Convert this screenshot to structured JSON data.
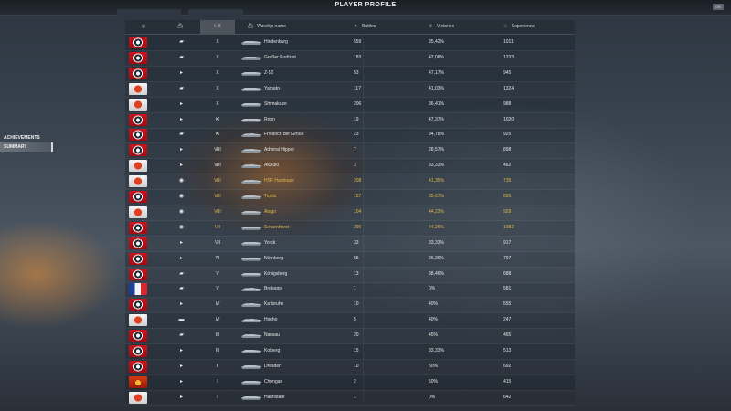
{
  "header": {
    "title": "PLAYER PROFILE",
    "settings_label": "ON"
  },
  "sidebar": {
    "items": [
      {
        "label": "ACHIEVEMENTS"
      },
      {
        "label": "SUMMARY"
      }
    ]
  },
  "columns": {
    "tier": "I–X",
    "ship": "Warship name",
    "battles": "Battles",
    "victories": "Victories",
    "experience": "Experience"
  },
  "ships": [
    {
      "flag": "ussr",
      "type": "BB",
      "tier": "X",
      "name": "Hindenburg",
      "battles": "559",
      "victories": "35,42%",
      "exp": "1011",
      "highlight": false
    },
    {
      "flag": "ussr",
      "type": "BB",
      "tier": "X",
      "name": "Großer Kurfürst",
      "battles": "183",
      "victories": "42,08%",
      "exp": "1233",
      "highlight": false
    },
    {
      "flag": "ussr",
      "type": "DD",
      "tier": "X",
      "name": "Z-52",
      "battles": "53",
      "victories": "47,17%",
      "exp": "945",
      "highlight": false
    },
    {
      "flag": "jp",
      "type": "BB",
      "tier": "X",
      "name": "Yamato",
      "battles": "117",
      "victories": "41,03%",
      "exp": "1324",
      "highlight": false
    },
    {
      "flag": "jp",
      "type": "DD",
      "tier": "X",
      "name": "Shimakaze",
      "battles": "206",
      "victories": "36,41%",
      "exp": "988",
      "highlight": false
    },
    {
      "flag": "ussr",
      "type": "CA",
      "tier": "IX",
      "name": "Roon",
      "battles": "19",
      "victories": "47,37%",
      "exp": "1020",
      "highlight": false
    },
    {
      "flag": "ussr",
      "type": "BB",
      "tier": "IX",
      "name": "Friedrich der Große",
      "battles": "23",
      "victories": "34,78%",
      "exp": "925",
      "highlight": false
    },
    {
      "flag": "ussr",
      "type": "CA",
      "tier": "VIII",
      "name": "Admiral Hipper",
      "battles": "7",
      "victories": "28,57%",
      "exp": "898",
      "highlight": false
    },
    {
      "flag": "jp",
      "type": "DD",
      "tier": "VIII",
      "name": "Akizuki",
      "battles": "3",
      "victories": "33,33%",
      "exp": "462",
      "highlight": false
    },
    {
      "flag": "jp",
      "type": "DD",
      "tier": "VIII",
      "name": "HSF Harekaze",
      "battles": "208",
      "victories": "41,35%",
      "exp": "735",
      "highlight": true
    },
    {
      "flag": "ussr",
      "type": "BB",
      "tier": "VIII",
      "name": "Tirpitz",
      "battles": "157",
      "victories": "35,67%",
      "exp": "895",
      "highlight": true
    },
    {
      "flag": "jp",
      "type": "CA",
      "tier": "VIII",
      "name": "Atago",
      "battles": "104",
      "victories": "44,23%",
      "exp": "928",
      "highlight": true
    },
    {
      "flag": "ussr",
      "type": "BB",
      "tier": "VII",
      "name": "Scharnhorst",
      "battles": "296",
      "victories": "44,26%",
      "exp": "1082",
      "highlight": true
    },
    {
      "flag": "ussr",
      "type": "CA",
      "tier": "VII",
      "name": "Yorck",
      "battles": "33",
      "victories": "33,33%",
      "exp": "917",
      "highlight": false
    },
    {
      "flag": "ussr",
      "type": "CA",
      "tier": "VI",
      "name": "Nürnberg",
      "battles": "55",
      "victories": "36,36%",
      "exp": "797",
      "highlight": false
    },
    {
      "flag": "ussr",
      "type": "BB",
      "tier": "V",
      "name": "Königsberg",
      "battles": "13",
      "victories": "38,46%",
      "exp": "688",
      "highlight": false
    },
    {
      "flag": "fr",
      "type": "BB",
      "tier": "V",
      "name": "Bretagne",
      "battles": "1",
      "victories": "0%",
      "exp": "581",
      "highlight": false
    },
    {
      "flag": "ussr",
      "type": "CA",
      "tier": "IV",
      "name": "Karlsruhe",
      "battles": "10",
      "victories": "40%",
      "exp": "555",
      "highlight": false
    },
    {
      "flag": "jp",
      "type": "CV",
      "tier": "IV",
      "name": "Hosho",
      "battles": "5",
      "victories": "40%",
      "exp": "247",
      "highlight": false
    },
    {
      "flag": "ussr",
      "type": "BB",
      "tier": "III",
      "name": "Nassau",
      "battles": "20",
      "victories": "45%",
      "exp": "465",
      "highlight": false
    },
    {
      "flag": "ussr",
      "type": "CA",
      "tier": "III",
      "name": "Kolberg",
      "battles": "15",
      "victories": "33,33%",
      "exp": "513",
      "highlight": false
    },
    {
      "flag": "ussr",
      "type": "CA",
      "tier": "II",
      "name": "Dresden",
      "battles": "10",
      "victories": "60%",
      "exp": "692",
      "highlight": false
    },
    {
      "flag": "pan",
      "type": "CA",
      "tier": "I",
      "name": "Chengan",
      "battles": "2",
      "victories": "50%",
      "exp": "415",
      "highlight": false
    },
    {
      "flag": "jp",
      "type": "CA",
      "tier": "I",
      "name": "Hashidate",
      "battles": "1",
      "victories": "0%",
      "exp": "642",
      "highlight": false
    }
  ]
}
